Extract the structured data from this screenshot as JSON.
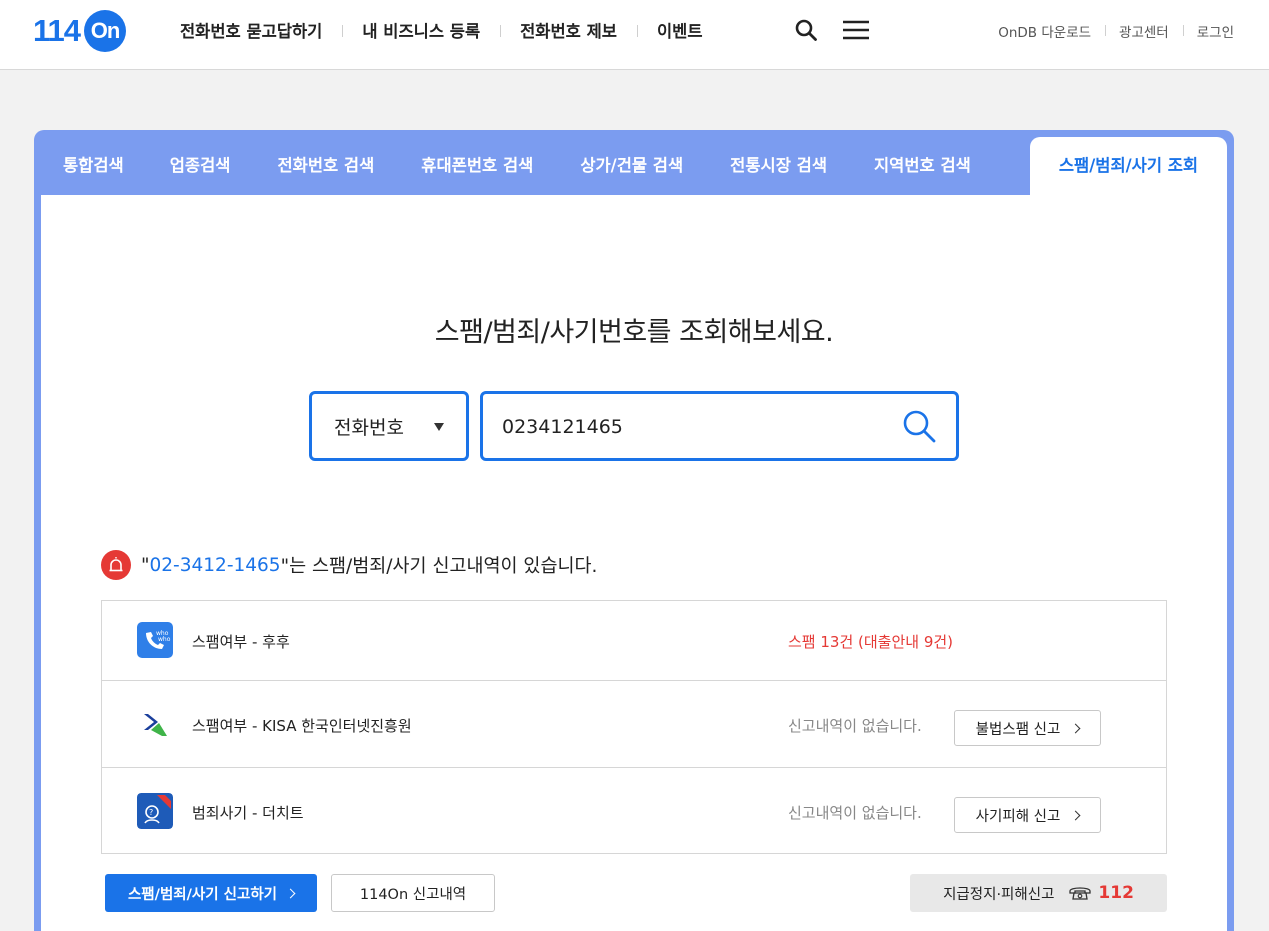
{
  "header": {
    "logo_num": "114",
    "logo_on": "On",
    "nav": [
      "전화번호 묻고답하기",
      "내 비즈니스 등록",
      "전화번호 제보",
      "이벤트"
    ],
    "util": [
      "OnDB 다운로드",
      "광고센터",
      "로그인"
    ]
  },
  "tabs": [
    "통합검색",
    "업종검색",
    "전화번호 검색",
    "휴대폰번호 검색",
    "상가/건물 검색",
    "전통시장 검색",
    "지역번호 검색",
    "스팸/범죄/사기 조회"
  ],
  "search": {
    "headline": "스팸/범죄/사기번호를 조회해보세요.",
    "select_value": "전화번호",
    "input_value": "0234121465"
  },
  "alert": {
    "quote_open": "\"",
    "number": "02-3412-1465",
    "message": "\"는 스팸/범죄/사기 신고내역이 있습니다."
  },
  "results": [
    {
      "label": "스팸여부 - 후후",
      "status": "스팸 13건 (대출안내 9건)",
      "status_color": "#e53935",
      "icon": "whowho-app-icon"
    },
    {
      "label": "스팸여부 - KISA 한국인터넷진흥원",
      "status": "신고내역이 없습니다.",
      "button": "불법스팸 신고",
      "icon": "kisa-logo-icon"
    },
    {
      "label": "범죄사기 - 더치트",
      "status": "신고내역이 없습니다.",
      "button": "사기피해 신고",
      "icon": "thecheat-app-icon"
    }
  ],
  "bottom": {
    "report_button": "스팸/범죄/사기 신고하기",
    "history_button": "114On 신고내역",
    "emergency_label": "지급정지·피해신고",
    "emergency_number": "112"
  },
  "colors": {
    "accent": "#1a73e8",
    "panel": "#7b9cf0",
    "alert_red": "#e53935"
  }
}
